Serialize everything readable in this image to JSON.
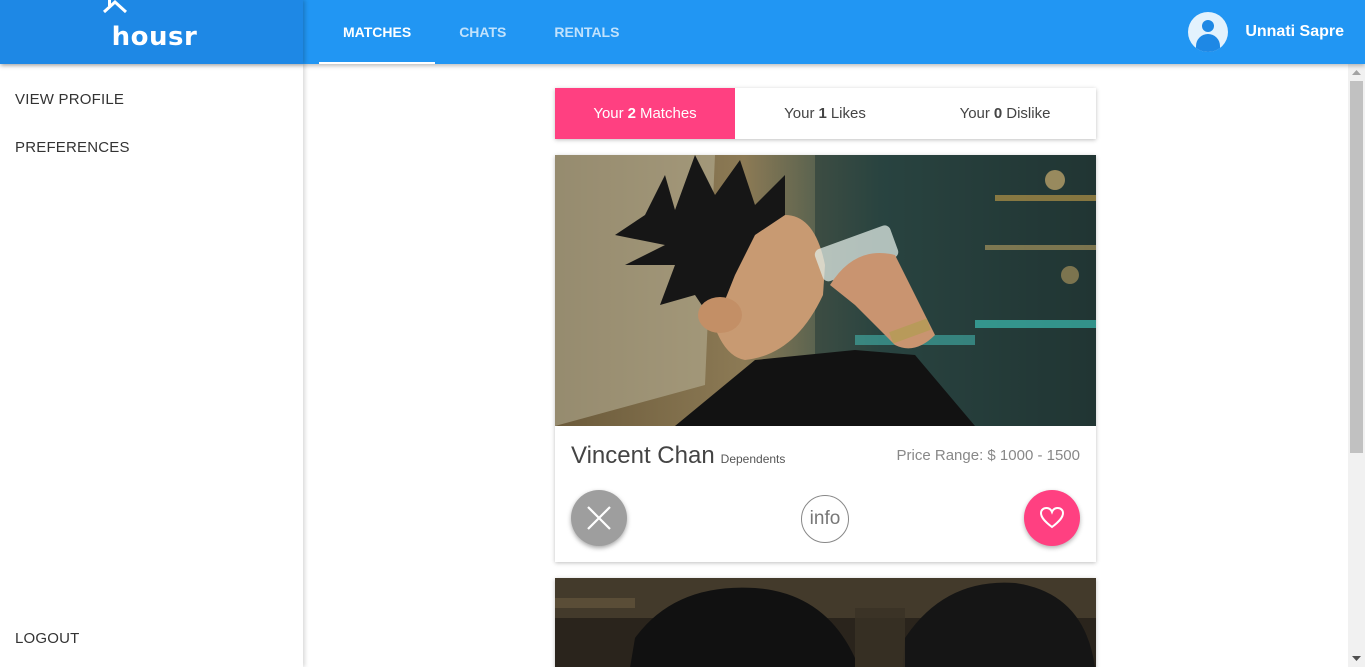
{
  "app": {
    "logo_text": "housr",
    "brand_color": "#2196f3",
    "accent_color": "#ff4081"
  },
  "nav": {
    "tabs": [
      {
        "label": "MATCHES",
        "active": true
      },
      {
        "label": "CHATS",
        "active": false
      },
      {
        "label": "RENTALS",
        "active": false
      }
    ]
  },
  "user": {
    "name": "Unnati Sapre",
    "avatar_icon": "user-avatar-icon"
  },
  "sidebar": {
    "items": [
      {
        "label": "VIEW PROFILE"
      },
      {
        "label": "PREFERENCES"
      },
      {
        "label": "LOGOUT"
      }
    ]
  },
  "counts": {
    "matches": {
      "prefix": "Your",
      "count": "2",
      "suffix": "Matches",
      "active": true
    },
    "likes": {
      "prefix": "Your",
      "count": "1",
      "suffix": "Likes",
      "active": false
    },
    "dislikes": {
      "prefix": "Your",
      "count": "0",
      "suffix": "Dislike",
      "active": false
    }
  },
  "cards": [
    {
      "name": "Vincent Chan",
      "tag": "Dependents",
      "price": "Price Range: $ 1000 - 1500",
      "info_label": "info",
      "dislike_icon": "close-icon",
      "like_icon": "heart-icon"
    }
  ]
}
